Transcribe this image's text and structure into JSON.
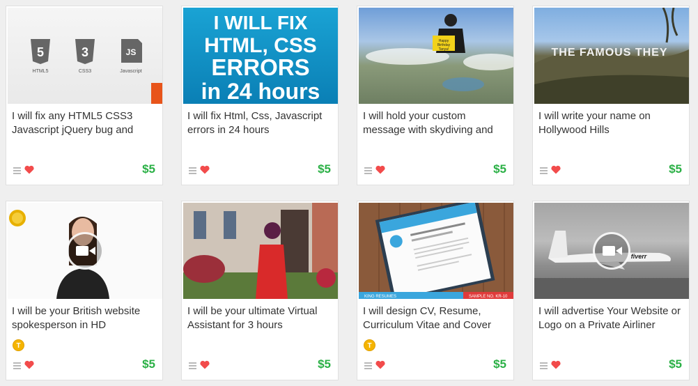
{
  "gigs": [
    {
      "title": "I will fix any HTML5 CSS3 Javascript jQuery bug and",
      "price": "$5",
      "image_label": [
        "HTML5",
        "CSS3",
        "Javascript"
      ],
      "badge": ""
    },
    {
      "title": "I will fix Html, Css, Javascript errors in 24 hours",
      "price": "$5",
      "image_text": [
        "I WILL FIX",
        "HTML, CSS",
        "ERRORS",
        "in 24 hours"
      ],
      "badge": ""
    },
    {
      "title": "I will hold your custom message with skydiving and",
      "price": "$5",
      "sign": "Happy Birthday Tanya!",
      "badge": ""
    },
    {
      "title": "I will write your name on Hollywood Hills",
      "price": "$5",
      "image_text": "THE FAMOUS THEY",
      "badge": ""
    },
    {
      "title": "I will be your British website spokesperson in HD",
      "price": "$5",
      "badge": "T",
      "video": true
    },
    {
      "title": "I will be your ultimate Virtual Assistant for 3 hours",
      "price": "$5",
      "badge": ""
    },
    {
      "title": "I will design CV, Resume, Curriculum Vitae and Cover",
      "price": "$5",
      "badge": "T",
      "image_text": [
        "KING RESUMES",
        "SAMPLE NO. KR-10"
      ]
    },
    {
      "title": "I will advertise Your Website or Logo on a Private Airliner",
      "price": "$5",
      "badge": "",
      "video": true,
      "image_text": "fiverr"
    }
  ],
  "colors": {
    "price": "#2ab045",
    "heart": "#f24b4b",
    "badge": "#f5b400"
  }
}
